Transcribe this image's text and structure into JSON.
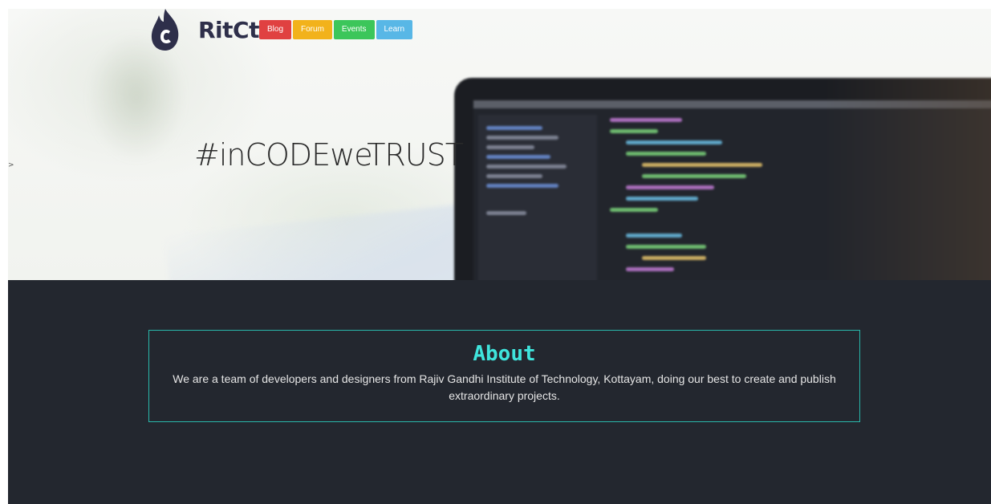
{
  "header": {
    "brand": "RitCt",
    "nav": [
      {
        "label": "Blog",
        "color": "#e04141"
      },
      {
        "label": "Forum",
        "color": "#f2b21b"
      },
      {
        "label": "Events",
        "color": "#3cc65a"
      },
      {
        "label": "Learn",
        "color": "#58b7e6"
      }
    ],
    "logo_color": "#2e2f4a"
  },
  "hero": {
    "arrow": ">",
    "tagline": "#inCODEweTRUST"
  },
  "about": {
    "title": "About",
    "text": "We are a team of developers and designers from Rajiv Gandhi Institute of Technology, Kottayam, doing our best to create and publish extraordinary projects.",
    "border_color": "#29b8ab",
    "title_color": "#3fe4dc",
    "background": "#23272f"
  }
}
